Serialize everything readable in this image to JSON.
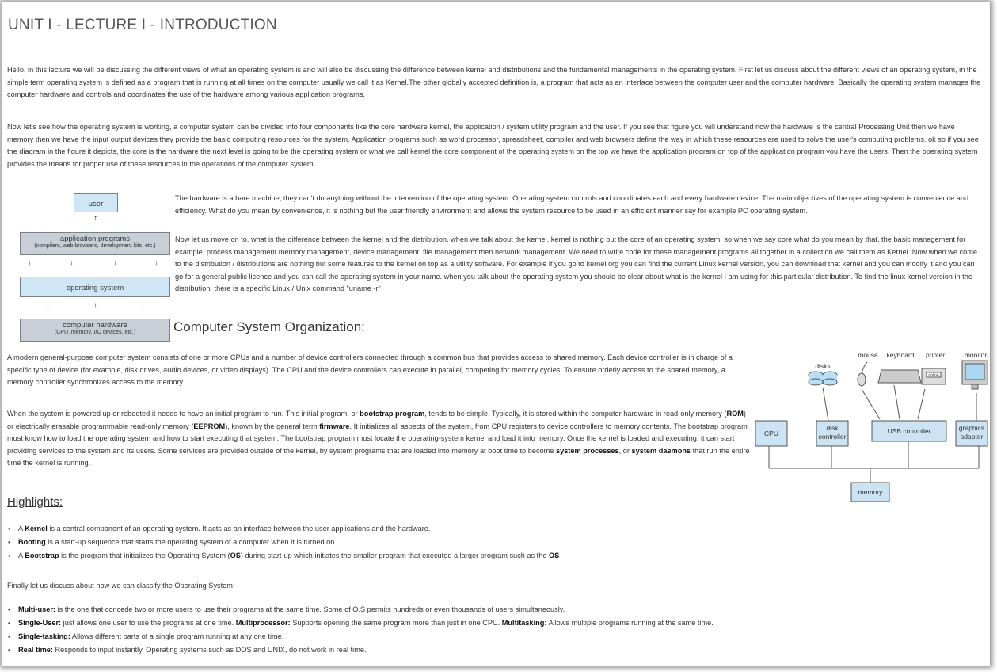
{
  "title": "UNIT I - LECTURE I - INTRODUCTION",
  "paragraphs": {
    "p1": "Hello, in this lecture we will be discussing the different views of what an operating system is and will also be discussing the difference between kernel and distributions and the fundamental managements in the operating system. First let us discuss about the different views of an operating system, in the simple term operating system is defined as a program that is running at all times on the computer usually we call it as Kernel.The other globally accepted definition is, a program that acts as an interface between the computer user and the computer hardware. Basically the operating system manages the computer hardware and controls and coordinates the use of the hardware among various application programs.",
    "p2": "Now let's see how the operating system is working, a computer system can be divided into four components like the core hardware kernel, the application / system utility program and the user. If you see that figure you will understand now the hardware is the central Processing Unit then we have memory then we have the input output devices they provide the basic computing resources for the system.  Application programs such as word processor, spreadsheet, compiler and web browsers define the way in which these resources are used to solve the user's computing problems. ok so if you see the diagram in the figure it depicts, the core is the hardware the next level is going to be the operating system or what we call kernel the core component of the operating system on the top we have the application program on top of the application program you have the users. Then the operating system provides the means for proper use of these resources in the operations of the computer system.",
    "p3": "The hardware is a bare machine, they can't do anything without the intervention of the operating system. Operating system controls and coordinates each and every hardware device. The main objectives of the operating system is convenience and efficiency. What do you mean by convenience, it is nothing but the user friendly environment and allows the system resource to be used in an efficient manner say for example  PC operating system.",
    "p4": "Now let us move on to, what is the difference between the kernel and the distribution,  when we talk about the kernel, kernel is nothing but the core of an operating system, so when we say core what do you mean by that, the basic management for example, process management memory management, device management, file management then network management. We need to write code for these management programs all together in a collection we call them as Kernel. Now when we come to the distribution / distributions are nothing but some features to the kernel on top as a utility software.  For example if you go to kernel.org  you can find the current Linux kernel version, you can download that kernel and you can modify it and you can go for a general public licence and you can call the operating system in your name. when you talk about the operating system you should be clear about what is the kernel I am using for this particular distribution.  To find the linux kernel version in the distribution, there is a specific Linux / Unix command  \"uname -r\"",
    "section_title": "Computer System Organization:",
    "p5": "A modern general-purpose computer system consists of one or more CPUs and a number of device controllers connected through a common bus that provides access to shared memory. Each device controller is in charge of a specific type of device (for example, disk drives, audio devices, or video displays). The CPU and the device controllers can execute in parallel, competing for memory cycles. To ensure orderly access to the shared memory, a memory controller synchronizes access to the memory.",
    "p6_a": "When the system is powered up or rebooted it needs to have an initial program to run. This initial program, or ",
    "p6_b1": "bootstrap program",
    "p6_c": ", tends to be simple. Typically, it is stored within the computer hardware in read-only memory (",
    "p6_b2": "ROM",
    "p6_d": ") or electrically erasable programmable read-only memory (",
    "p6_b3": "EEPROM",
    "p6_e": "), known by the general term ",
    "p6_b4": "firmware",
    "p6_f": ". It initializes all aspects of the system, from CPU registers to device controllers to memory contents. The bootstrap program must know how to load the operating system and how to start executing that system. The bootstrap program must locate the operating-system kernel and load it into memory. Once the kernel is loaded and executing, it can start providing services to the system and its users. Some services are provided outside of the kernel, by system programs that are loaded into memory at boot time to become ",
    "p6_b5": "system processes",
    "p6_g": ", or ",
    "p6_b6": "system daemons",
    "p6_h": " that run the entire time the kernel is running."
  },
  "highlights": {
    "title": "Highlights:",
    "items": [
      {
        "pre": "A ",
        "bold": "Kernel",
        "post": " is a central component of an operating system. It acts as an interface between the user applications and the hardware."
      },
      {
        "pre": "",
        "bold": "Booting",
        "post": " is a start-up sequence that starts the operating system of a computer when it is turned on."
      },
      {
        "pre": "A ",
        "bold": "Bootstrap",
        "post": " is the program that initializes the Operating System (",
        "bold2": "OS",
        "post2": ") during start-up which initiates the smaller program that executed a larger program such as the ",
        "bold3": "OS"
      }
    ]
  },
  "finally_text": "Finally let us discuss about how we can classify the Operating System:",
  "classification": [
    {
      "b1": "Multi-user:",
      "t1": " is the one that concede two or more users to use their programs at the same time. Some of O.S permits hundreds or even thousands of users simultaneously."
    },
    {
      "b1": "Single-User:",
      "t1": " just allows one user to use the programs at one time. ",
      "b2": "Multiprocessor:",
      "t2": " Supports opening the same program more than just in one CPU. ",
      "b3": "Multitasking:",
      "t3": " Allows multiple programs running at the same time."
    },
    {
      "b1": "Single-tasking:",
      "t1": " Allows different parts of a single program running at any one time."
    },
    {
      "b1": "Real time:",
      "t1": " Responds to input instantly. Operating systems such as DOS and UNIX, do not work in real time."
    }
  ],
  "layer_diagram": {
    "user": "user",
    "app": "application programs",
    "app_sub": "(compilers, web browsers, development kits, etc.)",
    "os": "operating system",
    "hw": "computer hardware",
    "hw_sub": "(CPU, memory, I/O devices, etc.)"
  },
  "org_diagram": {
    "labels": {
      "mouse": "mouse",
      "keyboard": "keyboard",
      "printer": "printer",
      "monitor": "monitor",
      "disks": "disks",
      "cpu": "CPU",
      "disk_ctrl_1": "disk",
      "disk_ctrl_2": "controller",
      "usb": "USB controller",
      "gfx_1": "graphics",
      "gfx_2": "adapter",
      "memory": "memory",
      "printer_screen": "online"
    },
    "colors": {
      "box": "#cbe3f3",
      "line": "#555555"
    }
  }
}
